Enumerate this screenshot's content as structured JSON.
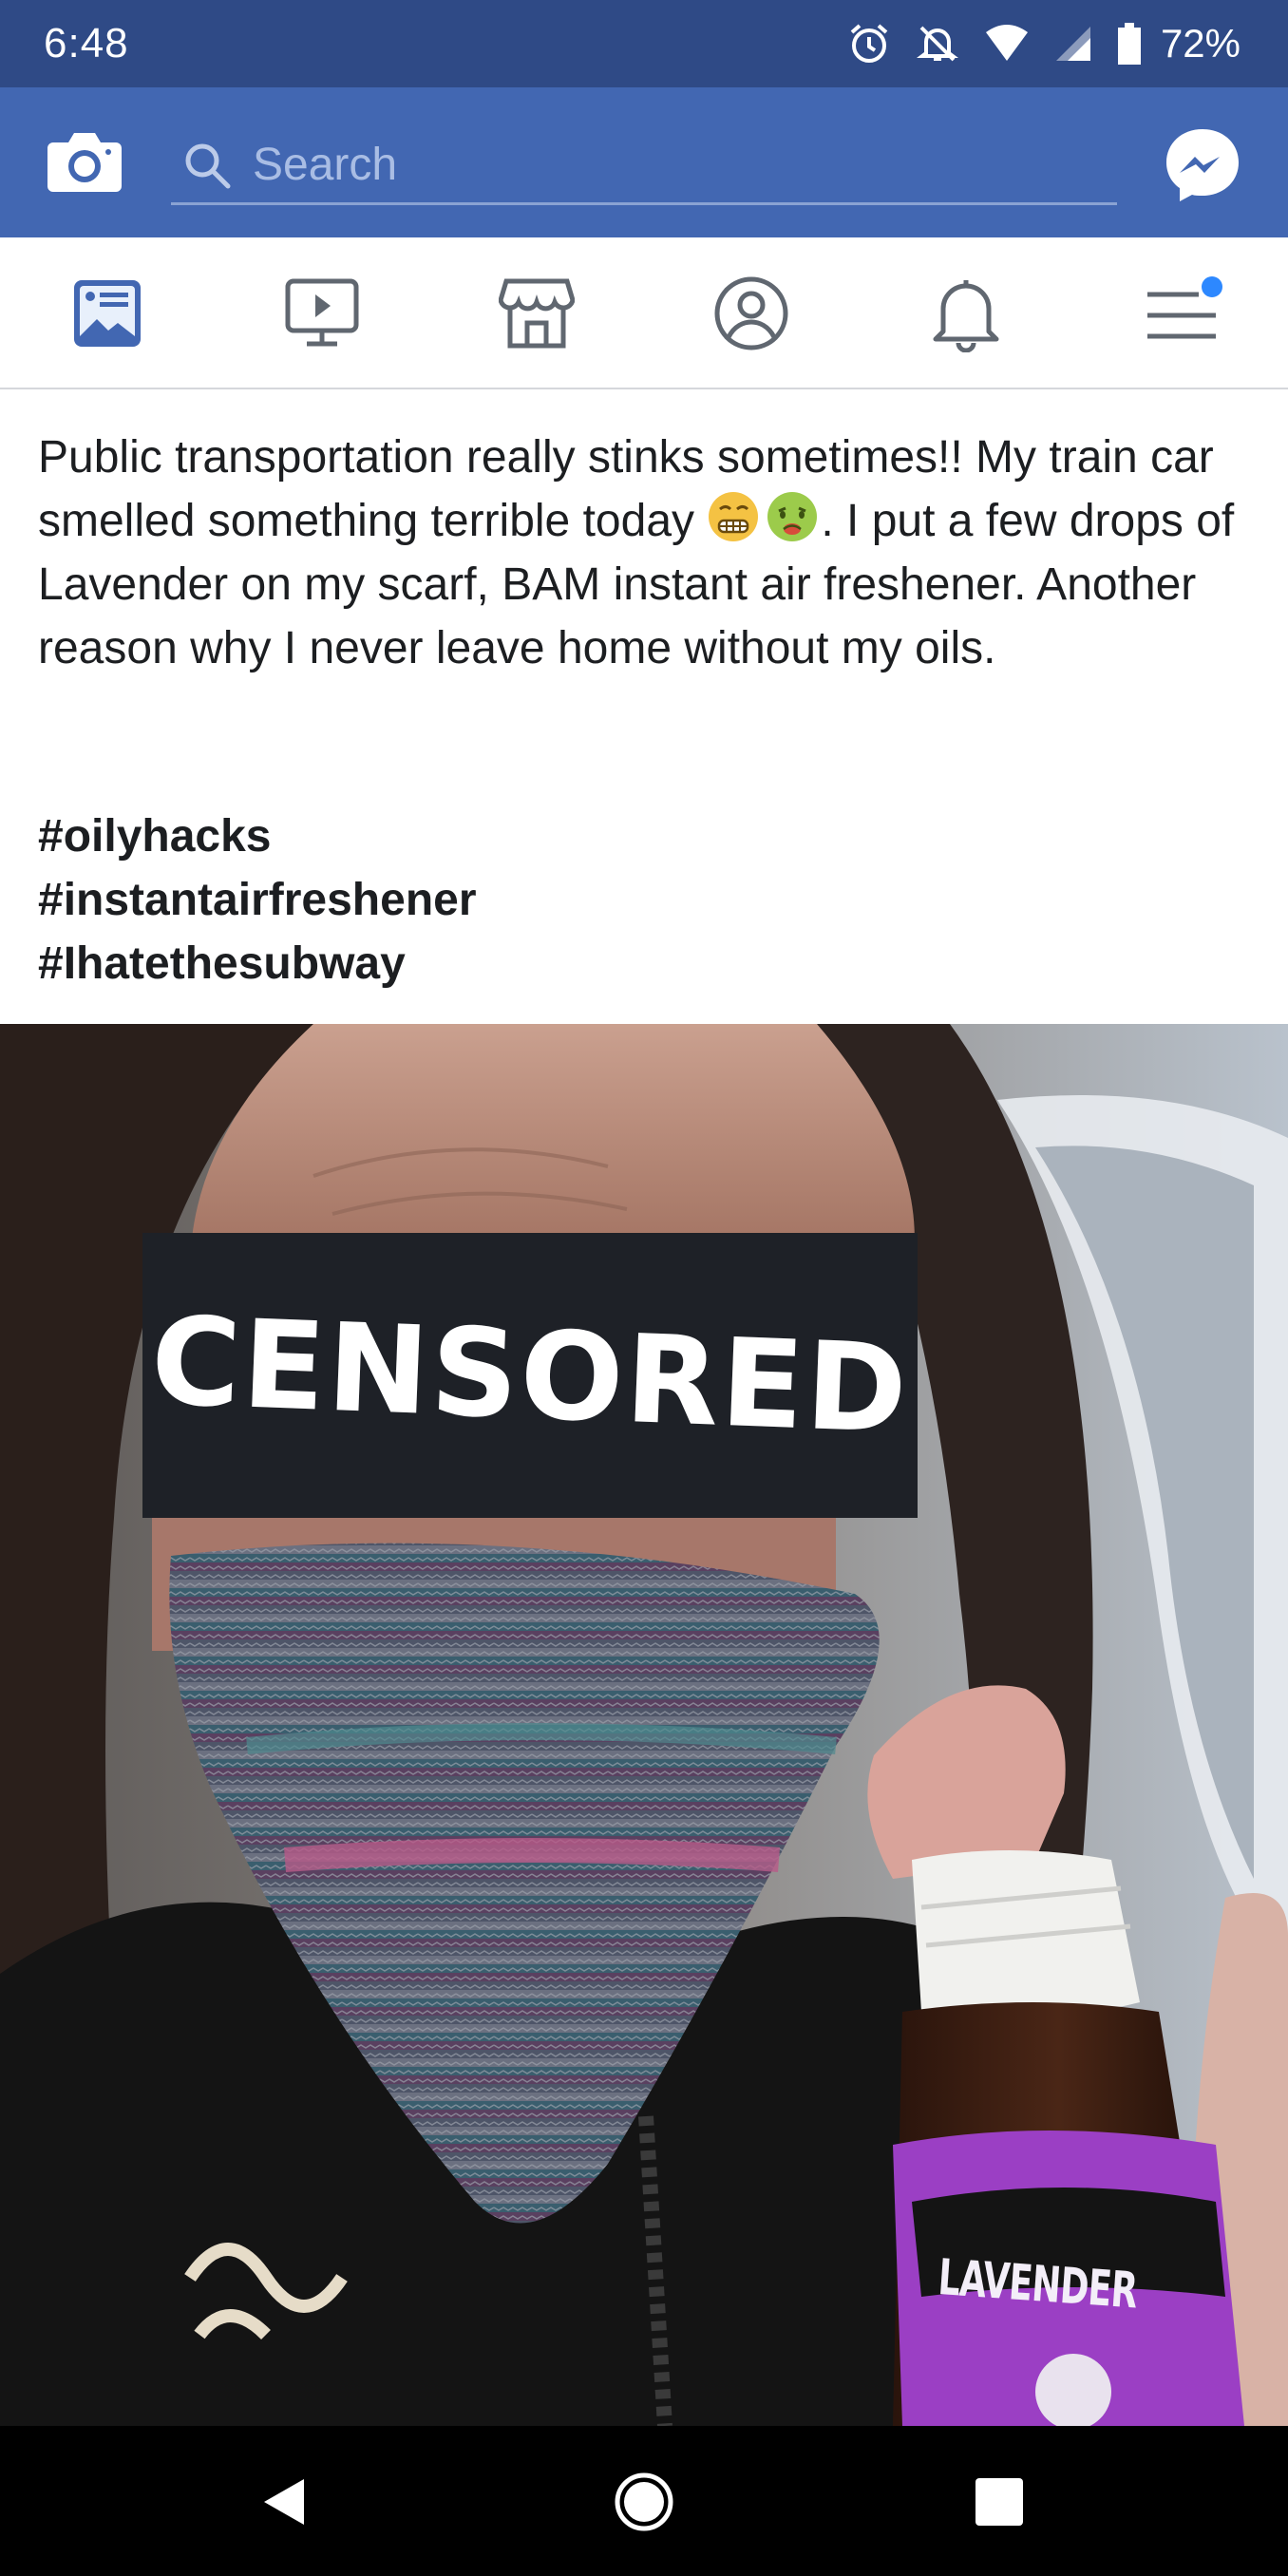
{
  "status_bar": {
    "time": "6:48",
    "battery": "72%",
    "icons": [
      "alarm-icon",
      "notifications-off-icon",
      "wifi-icon",
      "cell-signal-icon",
      "battery-icon"
    ]
  },
  "header": {
    "camera_icon": "camera-icon",
    "search_placeholder": "Search",
    "messenger_icon": "messenger-icon",
    "bg_color": "#4267b2"
  },
  "tabs": [
    {
      "name": "news-feed",
      "icon": "news-feed-icon",
      "active": true
    },
    {
      "name": "watch",
      "icon": "video-play-icon",
      "active": false
    },
    {
      "name": "marketplace",
      "icon": "marketplace-store-icon",
      "active": false
    },
    {
      "name": "profile",
      "icon": "profile-icon",
      "active": false
    },
    {
      "name": "notifications",
      "icon": "bell-icon",
      "active": false
    },
    {
      "name": "menu",
      "icon": "hamburger-menu-icon",
      "active": false,
      "badge_dot": true
    }
  ],
  "post": {
    "text_before_emoji": "Public transportation really stinks sometimes!! My train car smelled something terrible today ",
    "emojis": [
      "grimacing-face-emoji",
      "nauseated-face-emoji"
    ],
    "text_after_emoji": ". I put a few drops of Lavender on my scarf, BAM instant air freshener. Another reason why I never leave home without my oils.",
    "hashtags": [
      "#oilyhacks",
      "#instantairfreshener",
      "#Ihatethesubway"
    ]
  },
  "photo": {
    "censor_text": "CENSORED",
    "bottle_label": "LAVENDER"
  },
  "nav_bar": {
    "buttons": [
      "back-icon",
      "home-icon",
      "recents-icon"
    ]
  }
}
